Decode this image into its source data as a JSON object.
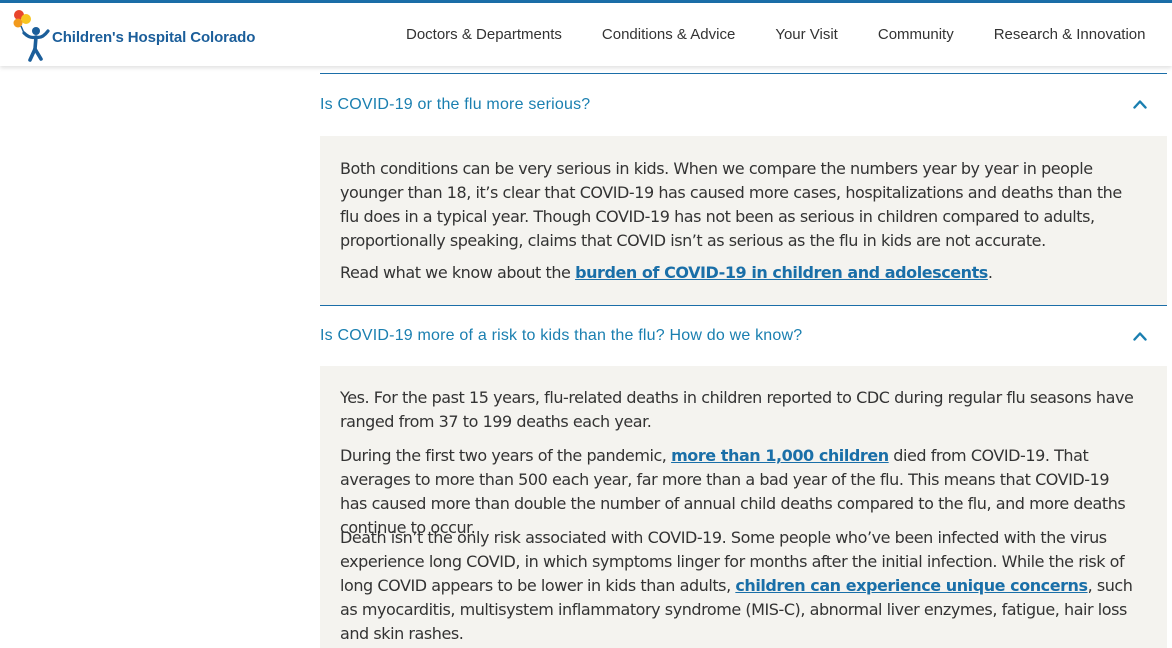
{
  "header": {
    "logo_text": "Children's Hospital Colorado",
    "nav": [
      "Doctors & Departments",
      "Conditions & Advice",
      "Your Visit",
      "Community",
      "Research & Innovation"
    ]
  },
  "faq": [
    {
      "question": "Is COVID-19 or the flu more serious?",
      "paragraphs": [
        {
          "text": "Both conditions can be very serious in kids. When we compare the numbers year by year in people younger than 18, it’s clear that COVID-19 has caused more cases, hospitalizations and deaths than the flu does in a typical year. Though COVID-19 has not been as serious in children compared to adults, proportionally speaking, claims that COVID isn’t as serious as the flu in kids are not accurate."
        },
        {
          "pre": "Read what we know about the ",
          "link": "burden of COVID-19 in children and adolescents",
          "post": "."
        }
      ]
    },
    {
      "question": "Is COVID-19 more of a risk to kids than the flu? How do we know?",
      "paragraphs": [
        {
          "text": "Yes. For the past 15 years, flu-related deaths in children reported to CDC during regular flu seasons have ranged from 37 to 199 deaths each year."
        },
        {
          "pre": "During the first two years of the pandemic, ",
          "link": "more than 1,000 children",
          "post": " died from COVID-19. That averages to more than 500 each year, far more than a bad year of the flu. This means that COVID-19 has caused more than double the number of annual child deaths compared to the flu, and more deaths continue to occur."
        },
        {
          "pre": "Death isn’t the only risk associated with COVID-19. Some people who’ve been infected with the virus experience long COVID, in which symptoms linger for months after the initial infection. While the risk of long COVID appears to be lower in kids than adults, ",
          "link": "children can experience unique concerns",
          "post": ", such as myocarditis, multisystem inflammatory syndrome (MIS-C), abnormal liver enzymes, fatigue, hair loss and skin rashes."
        }
      ]
    }
  ],
  "colors": {
    "brand_blue": "#1b6ea8",
    "link_blue": "#1a6fa8",
    "question_blue": "#1a7fb0",
    "panel_bg": "#f4f3ef"
  },
  "icons": {
    "logo": "balloon-child-logo-icon",
    "collapse": "chevron-up-icon"
  }
}
